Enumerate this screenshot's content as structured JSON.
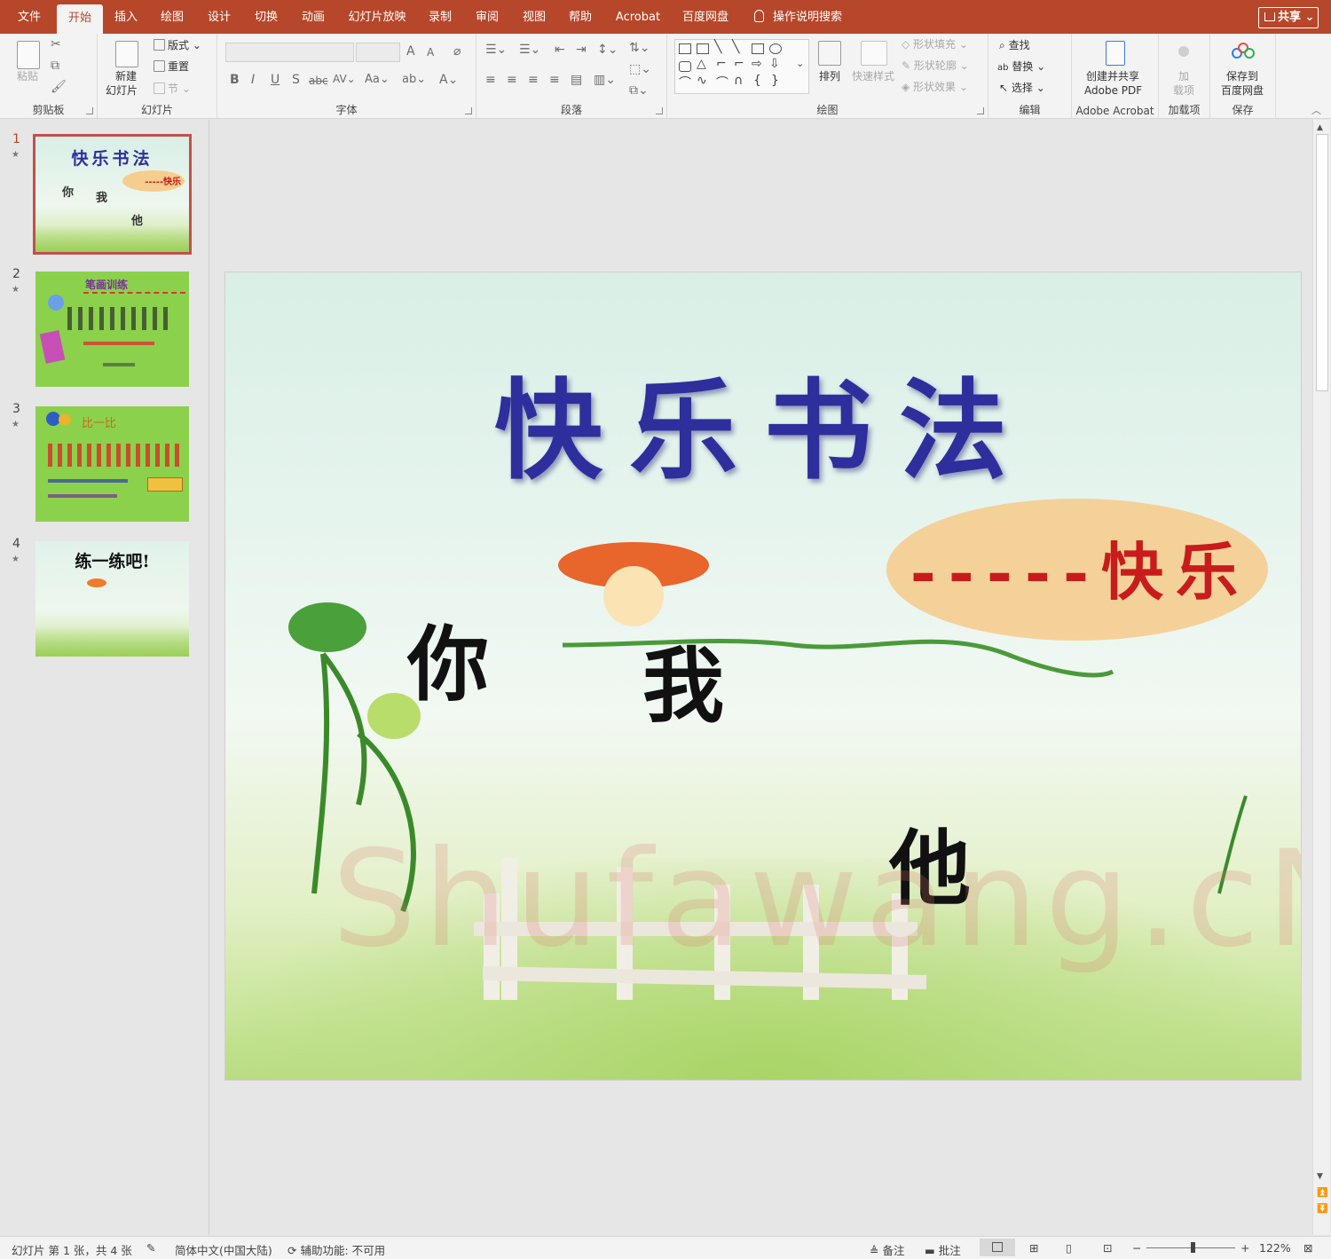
{
  "tabs": [
    "文件",
    "开始",
    "插入",
    "绘图",
    "设计",
    "切换",
    "动画",
    "幻灯片放映",
    "录制",
    "审阅",
    "视图",
    "帮助",
    "Acrobat",
    "百度网盘"
  ],
  "active_tab": "开始",
  "search_tell": "操作说明搜索",
  "share_label": "共享",
  "ribbon": {
    "clipboard": {
      "paste": "粘贴",
      "label": "剪贴板"
    },
    "slides": {
      "new_slide_1": "新建",
      "new_slide_2": "幻灯片",
      "layout": "版式",
      "reset": "重置",
      "section": "节",
      "label": "幻灯片"
    },
    "font": {
      "label": "字体"
    },
    "paragraph": {
      "label": "段落"
    },
    "drawing": {
      "arrange": "排列",
      "quick_styles": "快速样式",
      "shape_fill": "形状填充",
      "shape_outline": "形状轮廓",
      "shape_effects": "形状效果",
      "label": "绘图"
    },
    "editing": {
      "find": "查找",
      "replace": "替换",
      "select": "选择",
      "label": "编辑"
    },
    "acrobat": {
      "create_1": "创建并共享",
      "create_2": "Adobe PDF",
      "label": "Adobe Acrobat"
    },
    "addins": {
      "addin_1": "加",
      "addin_2": "载项",
      "label": "加载项"
    },
    "save": {
      "save_1": "保存到",
      "save_2": "百度网盘",
      "label": "保存"
    }
  },
  "thumbnails": [
    {
      "num": "1",
      "title": "快乐书法"
    },
    {
      "num": "2",
      "title": "笔画训练"
    },
    {
      "num": "3",
      "title": "比一比"
    },
    {
      "num": "4",
      "title": "练一练吧!"
    }
  ],
  "slide": {
    "title": "快乐书法",
    "subtitle": "-----快乐",
    "char_ni": "你",
    "char_wo": "我",
    "char_ta": "他",
    "watermark": "Shufawang.cN"
  },
  "statusbar": {
    "slide_info": "幻灯片 第 1 张，共 4 张",
    "language": "简体中文(中国大陆)",
    "accessibility": "辅助功能: 不可用",
    "notes": "备注",
    "comments": "批注",
    "zoom": "122%"
  },
  "colors": {
    "accent": "#b7472a",
    "title_blue": "#2e2e9c",
    "subtitle_red": "#c81c1c",
    "oval": "#f5cd8f"
  }
}
